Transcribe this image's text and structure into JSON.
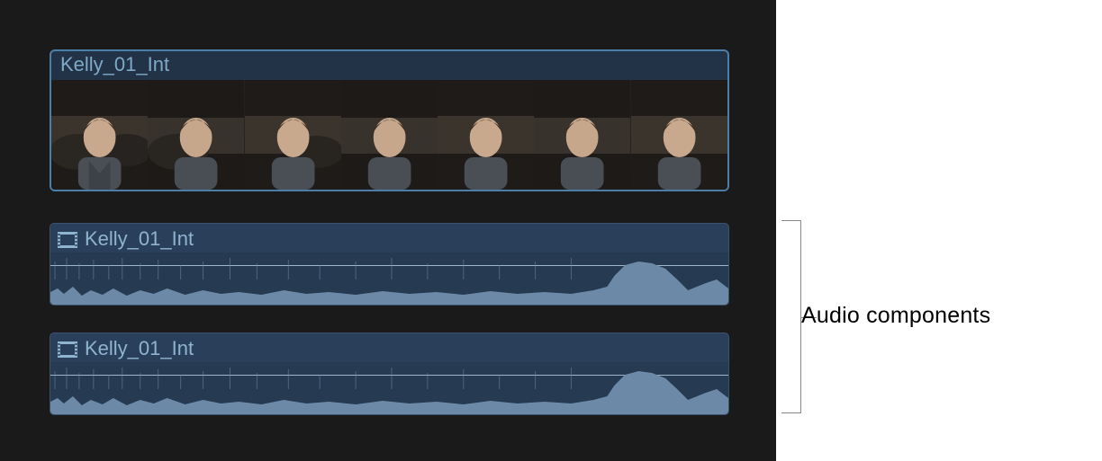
{
  "colors": {
    "panel_bg": "#1a1a1a",
    "clip_border": "#4d7ea8",
    "clip_bg": "#223348",
    "audio_bg": "#2a3f59",
    "text": "#7ea9c7",
    "wave_fill": "#6c8aa8"
  },
  "video_clip": {
    "title": "Kelly_01_Int",
    "thumbnail_count": 7
  },
  "audio_clips": [
    {
      "label": "Kelly_01_Int",
      "icon": "film-icon"
    },
    {
      "label": "Kelly_01_Int",
      "icon": "film-icon"
    }
  ],
  "annotation": {
    "label": "Audio components"
  }
}
